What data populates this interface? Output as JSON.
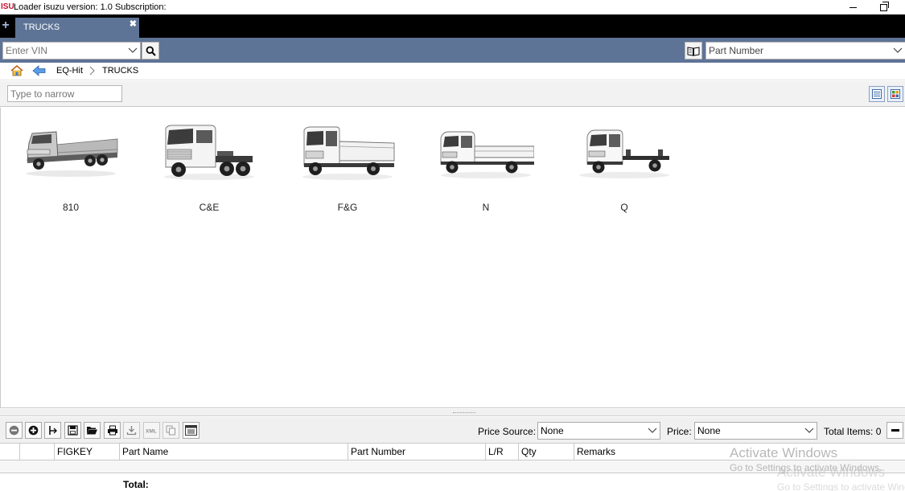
{
  "window": {
    "logo_text": "ISU",
    "title": "Loader isuzu version: 1.0 Subscription:"
  },
  "tabs": [
    {
      "label": "TRUCKS",
      "close_glyph": "✖"
    }
  ],
  "tabstrip": {
    "new_tab_glyph": "+"
  },
  "search": {
    "vin_placeholder": "Enter VIN",
    "part_number_selected": "Part Number"
  },
  "breadcrumb": {
    "items": [
      "EQ-Hit",
      "TRUCKS"
    ]
  },
  "filter": {
    "placeholder": "Type to narrow"
  },
  "models": [
    {
      "label": "810",
      "icon": "classic-truck-icon"
    },
    {
      "label": "C&E",
      "icon": "tractor-truck-icon"
    },
    {
      "label": "F&G",
      "icon": "tipper-truck-icon"
    },
    {
      "label": "N",
      "icon": "flatbed-truck-icon"
    },
    {
      "label": "Q",
      "icon": "chassis-cab-icon"
    }
  ],
  "toolbar": {
    "price_source_label": "Price Source:",
    "price_source_value": "None",
    "price_label": "Price:",
    "price_value": "None",
    "total_items": "Total Items: 0"
  },
  "parts_table": {
    "columns": [
      "",
      "",
      "FIGKEY",
      "Part Name",
      "Part Number",
      "L/R",
      "Qty",
      "Remarks"
    ],
    "rows": []
  },
  "footer": {
    "total_label": "Total:"
  },
  "watermark": {
    "title": "Activate Windows",
    "subtitle": "Go to Settings to activate Windows."
  },
  "colors": {
    "accent": "#5e7496",
    "tab_strip": "#000000",
    "logo_red": "#c8102e"
  }
}
